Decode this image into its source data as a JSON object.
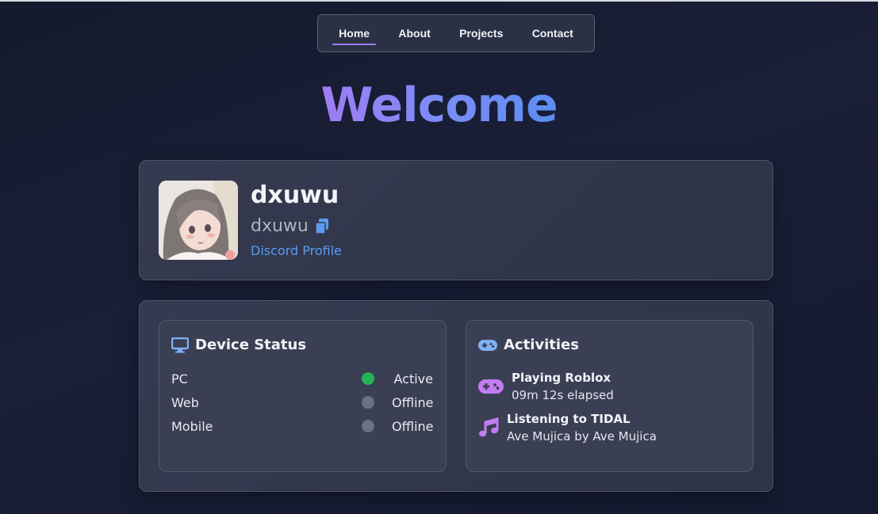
{
  "nav": {
    "items": [
      {
        "label": "Home",
        "active": true
      },
      {
        "label": "About",
        "active": false
      },
      {
        "label": "Projects",
        "active": false
      },
      {
        "label": "Contact",
        "active": false
      }
    ]
  },
  "hero": {
    "title": "Welcome"
  },
  "profile": {
    "display_name": "dxuwu",
    "username": "dxuwu",
    "link_text": "Discord Profile"
  },
  "device_status": {
    "title": "Device Status",
    "icon": "monitor-icon",
    "devices": [
      {
        "name": "PC",
        "state": "Active",
        "color": "#22b357"
      },
      {
        "name": "Web",
        "state": "Offline",
        "color": "#6b7183"
      },
      {
        "name": "Mobile",
        "state": "Offline",
        "color": "#6b7183"
      }
    ]
  },
  "activities": {
    "title": "Activities",
    "icon": "gamepad-icon",
    "items": [
      {
        "icon": "gamepad-icon",
        "title": "Playing Roblox",
        "detail": "09m 12s elapsed"
      },
      {
        "icon": "music-note-icon",
        "title": "Listening to TIDAL",
        "detail": "Ave Mujica by Ave Mujica"
      }
    ]
  },
  "colors": {
    "accent_purple": "#a07cf4",
    "accent_blue": "#5b9cf0",
    "status_active": "#22b357",
    "status_offline": "#6b7183"
  }
}
